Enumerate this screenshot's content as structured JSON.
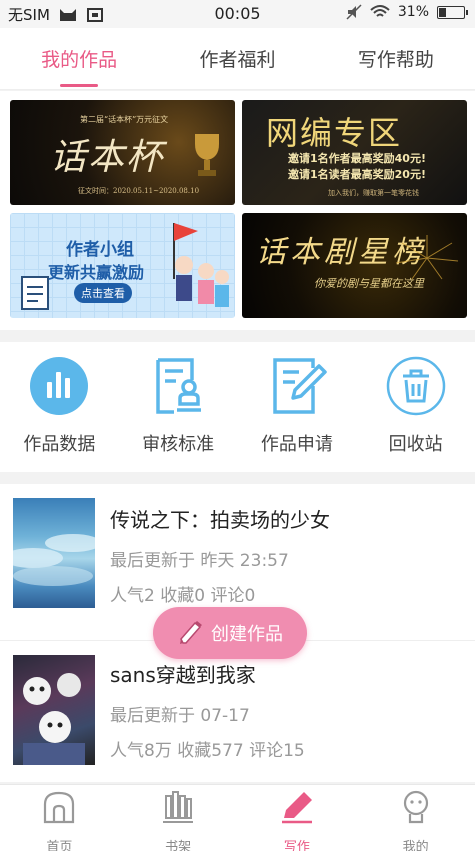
{
  "status_bar": {
    "carrier": "无SIM",
    "time": "00:05",
    "battery": "31%",
    "battery_level": 0.31
  },
  "tabs": [
    {
      "label": "我的作品",
      "active": true
    },
    {
      "label": "作者福利",
      "active": false
    },
    {
      "label": "写作帮助",
      "active": false
    }
  ],
  "banners": {
    "b1": {
      "top": "第二届“话本杯”万元征文",
      "main": "话本杯",
      "date": "征文时间：2020.05.11~2020.08.10"
    },
    "b2": {
      "main": "网编专区",
      "line1": "邀请1名作者最高奖励40元!",
      "line2": "邀请1名读者最高奖励20元!",
      "line3": "加入我们，赚取第一笔零花钱"
    },
    "b3": {
      "line1": "作者小组",
      "line2": "更新共赢激励",
      "button": "点击查看"
    },
    "b4": {
      "main": "话本剧星榜",
      "sub": "你爱的剧与星都在这里"
    }
  },
  "shortcuts": [
    {
      "label": "作品数据",
      "icon": "bar-chart-icon"
    },
    {
      "label": "审核标准",
      "icon": "review-stamp-icon"
    },
    {
      "label": "作品申请",
      "icon": "edit-document-icon"
    },
    {
      "label": "回收站",
      "icon": "trash-icon"
    }
  ],
  "works": [
    {
      "title": "传说之下：拍卖场的少女",
      "updated": "最后更新于 昨天 23:57",
      "stats": "人气2  收藏0  评论0"
    },
    {
      "title": "sans穿越到我家",
      "updated": "最后更新于 07-17",
      "stats": "人气8万  收藏577  评论15"
    }
  ],
  "fab": {
    "label": "创建作品",
    "icon": "pencil-icon"
  },
  "bottom_nav": [
    {
      "label": "首页",
      "icon": "home-icon",
      "active": false
    },
    {
      "label": "书架",
      "icon": "bookshelf-icon",
      "active": false
    },
    {
      "label": "写作",
      "icon": "write-pen-icon",
      "active": true
    },
    {
      "label": "我的",
      "icon": "profile-icon",
      "active": false
    }
  ],
  "colors": {
    "accent": "#e95a86",
    "icon_blue": "#5bb7ea"
  }
}
